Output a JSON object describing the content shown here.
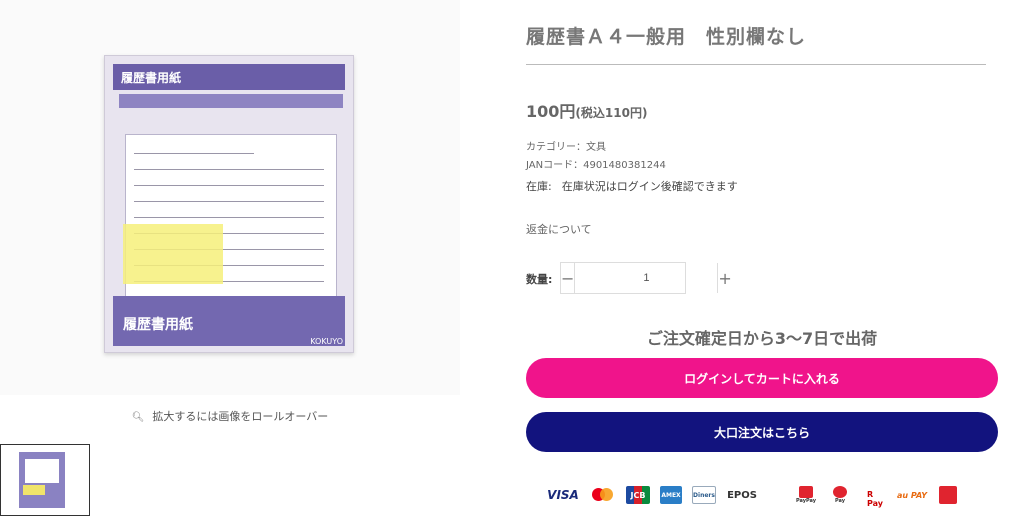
{
  "product": {
    "title": "履歴書Ａ４一般用　性別欄なし",
    "price": "100円",
    "price_tax": "(税込110円)",
    "category": "カテゴリー：文具",
    "jan": "JANコード：4901480381244",
    "stock_label": "在庫:",
    "stock_status": "在庫状況はログイン後確認できます",
    "refund_link": "返金について"
  },
  "gallery": {
    "zoom_hint": "拡大するには画像をロールオーバー",
    "pack_header": "履歴書用紙",
    "pack_footer": "履歴書用紙",
    "pack_logo": "KOKUYO"
  },
  "quantity": {
    "label": "数量:",
    "value": "1",
    "minus": "−",
    "plus": "+"
  },
  "shipping": "ご注文確定日から3〜7日で出荷",
  "buttons": {
    "cart": "ログインしてカートに入れる",
    "bulk": "大口注文はこちら"
  },
  "payments": {
    "visa": "VISA",
    "jcb": "JCB",
    "amex": "AMEX",
    "diners": "Diners",
    "epos": "EPOS",
    "paypay": "PayPay",
    "mpay": "Pay",
    "rpay": "R Pay",
    "aupay": "au PAY"
  }
}
